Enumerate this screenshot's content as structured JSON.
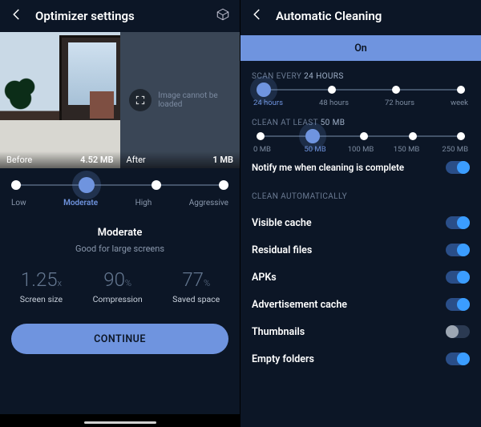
{
  "left": {
    "title": "Optimizer settings",
    "preview": {
      "before_label": "Before",
      "before_size": "4.52 MB",
      "after_label": "After",
      "after_size": "1 MB",
      "error_msg": "Image cannot be loaded"
    },
    "quality": {
      "labels": [
        "Low",
        "Moderate",
        "High",
        "Aggressive"
      ],
      "selected_index": 1
    },
    "desc": {
      "title": "Moderate",
      "sub": "Good for large screens"
    },
    "stats": {
      "screen_size": {
        "value": "1.25",
        "unit": "x",
        "label": "Screen size"
      },
      "compression": {
        "value": "90",
        "unit": "%",
        "label": "Compression"
      },
      "saved": {
        "value": "77",
        "unit": "%",
        "label": "Saved space"
      }
    },
    "continue": "CONTINUE"
  },
  "right": {
    "title": "Automatic Cleaning",
    "on_label": "On",
    "on_state": true,
    "scan": {
      "title_prefix": "SCAN EVERY",
      "title_value": "24 HOURS",
      "labels": [
        "24 hours",
        "48 hours",
        "72 hours",
        "week"
      ],
      "selected_index": 0
    },
    "clean": {
      "title_prefix": "CLEAN AT LEAST",
      "title_value": "50 MB",
      "labels": [
        "0 MB",
        "50 MB",
        "100 MB",
        "150 MB",
        "250 MB"
      ],
      "selected_index": 1
    },
    "notify": {
      "label": "Notify me when cleaning is complete",
      "on": true
    },
    "auto_title": "CLEAN AUTOMATICALLY",
    "options": [
      {
        "label": "Visible cache",
        "on": true
      },
      {
        "label": "Residual files",
        "on": true
      },
      {
        "label": "APKs",
        "on": true
      },
      {
        "label": "Advertisement cache",
        "on": true
      },
      {
        "label": "Thumbnails",
        "on": false
      },
      {
        "label": "Empty folders",
        "on": true
      }
    ]
  }
}
